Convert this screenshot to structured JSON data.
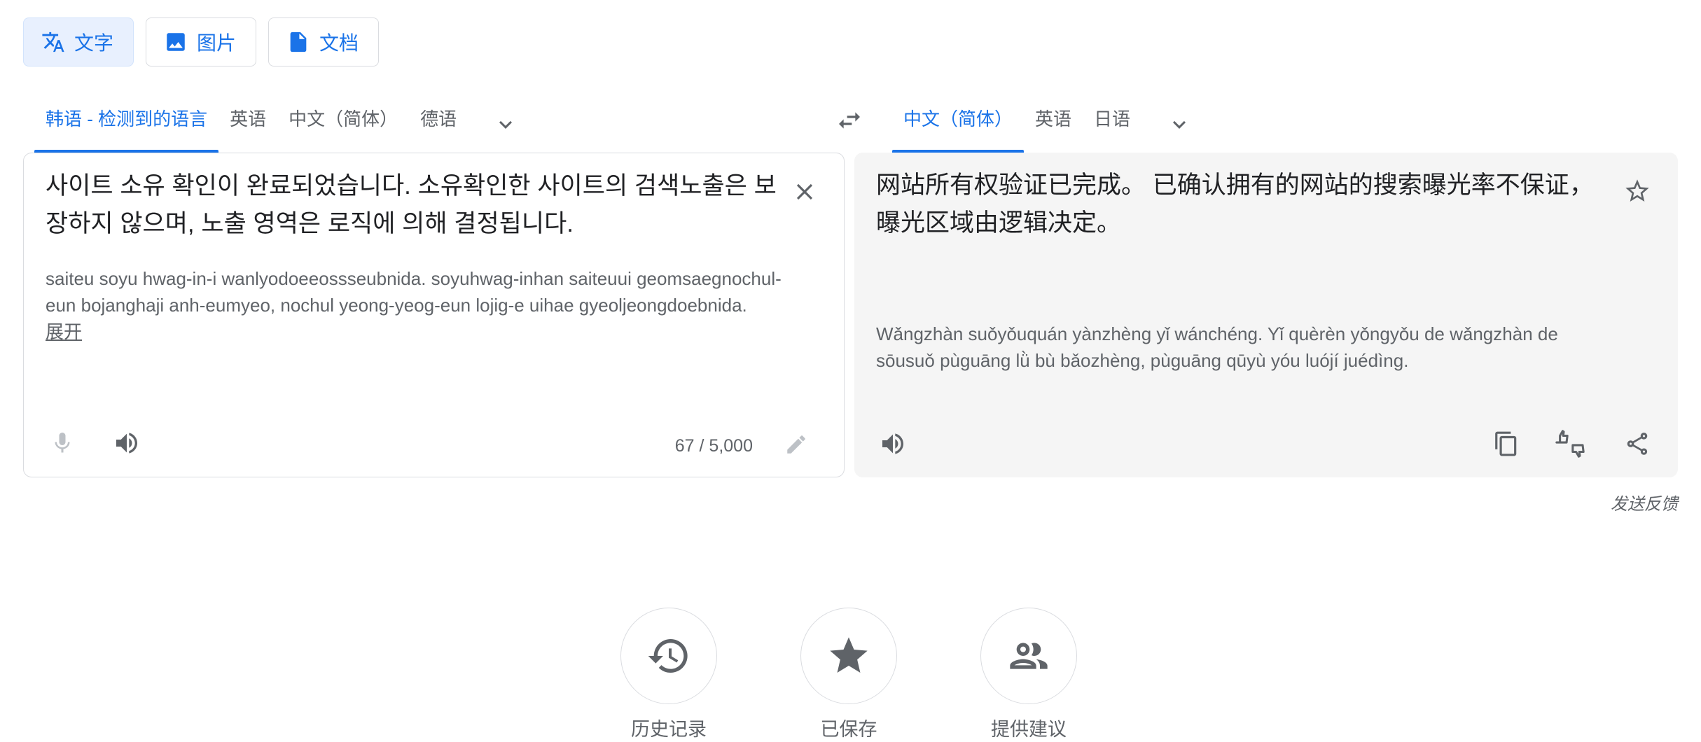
{
  "mode_tabs": [
    {
      "label": "文字",
      "icon": "translate-icon",
      "active": true
    },
    {
      "label": "图片",
      "icon": "image-icon",
      "active": false
    },
    {
      "label": "文档",
      "icon": "document-icon",
      "active": false
    }
  ],
  "source": {
    "languages": [
      "韩语 - 检测到的语言",
      "英语",
      "中文（简体）",
      "德语"
    ],
    "text": "사이트 소유 확인이 완료되었습니다. 소유확인한 사이트의 검색노출은 보장하지 않으며, 노출 영역은 로직에 의해 결정됩니다.",
    "romanization": "saiteu soyu hwag-in-i wanlyodoeeossseubnida. soyuhwag-inhan saiteuui geomsaegnochul-eun bojanghaji anh-eumyeo, nochul yeong-yeog-eun lojig-e uihae gyeoljeongdoebnida.",
    "expand_label": "展开",
    "char_count": "67 / 5,000"
  },
  "target": {
    "languages": [
      "中文（简体）",
      "英语",
      "日语"
    ],
    "text": "网站所有权验证已完成。 已确认拥有的网站的搜索曝光率不保证，曝光区域由逻辑决定。",
    "pinyin": "Wǎngzhàn suǒyǒuquán yànzhèng yǐ wánchéng. Yǐ quèrèn yǒngyǒu de wǎngzhàn de sōusuǒ pùguāng lǜ bù bǎozhèng, pùguāng qūyù yóu luójí juédìng."
  },
  "feedback_label": "发送反馈",
  "bottom_actions": [
    {
      "label": "历史记录",
      "icon": "history-icon"
    },
    {
      "label": "已保存",
      "icon": "star-icon"
    },
    {
      "label": "提供建议",
      "icon": "community-icon"
    }
  ],
  "colors": {
    "accent": "#1a73e8",
    "text": "#202124",
    "muted": "#5f6368",
    "target_bg": "#f5f5f5"
  }
}
